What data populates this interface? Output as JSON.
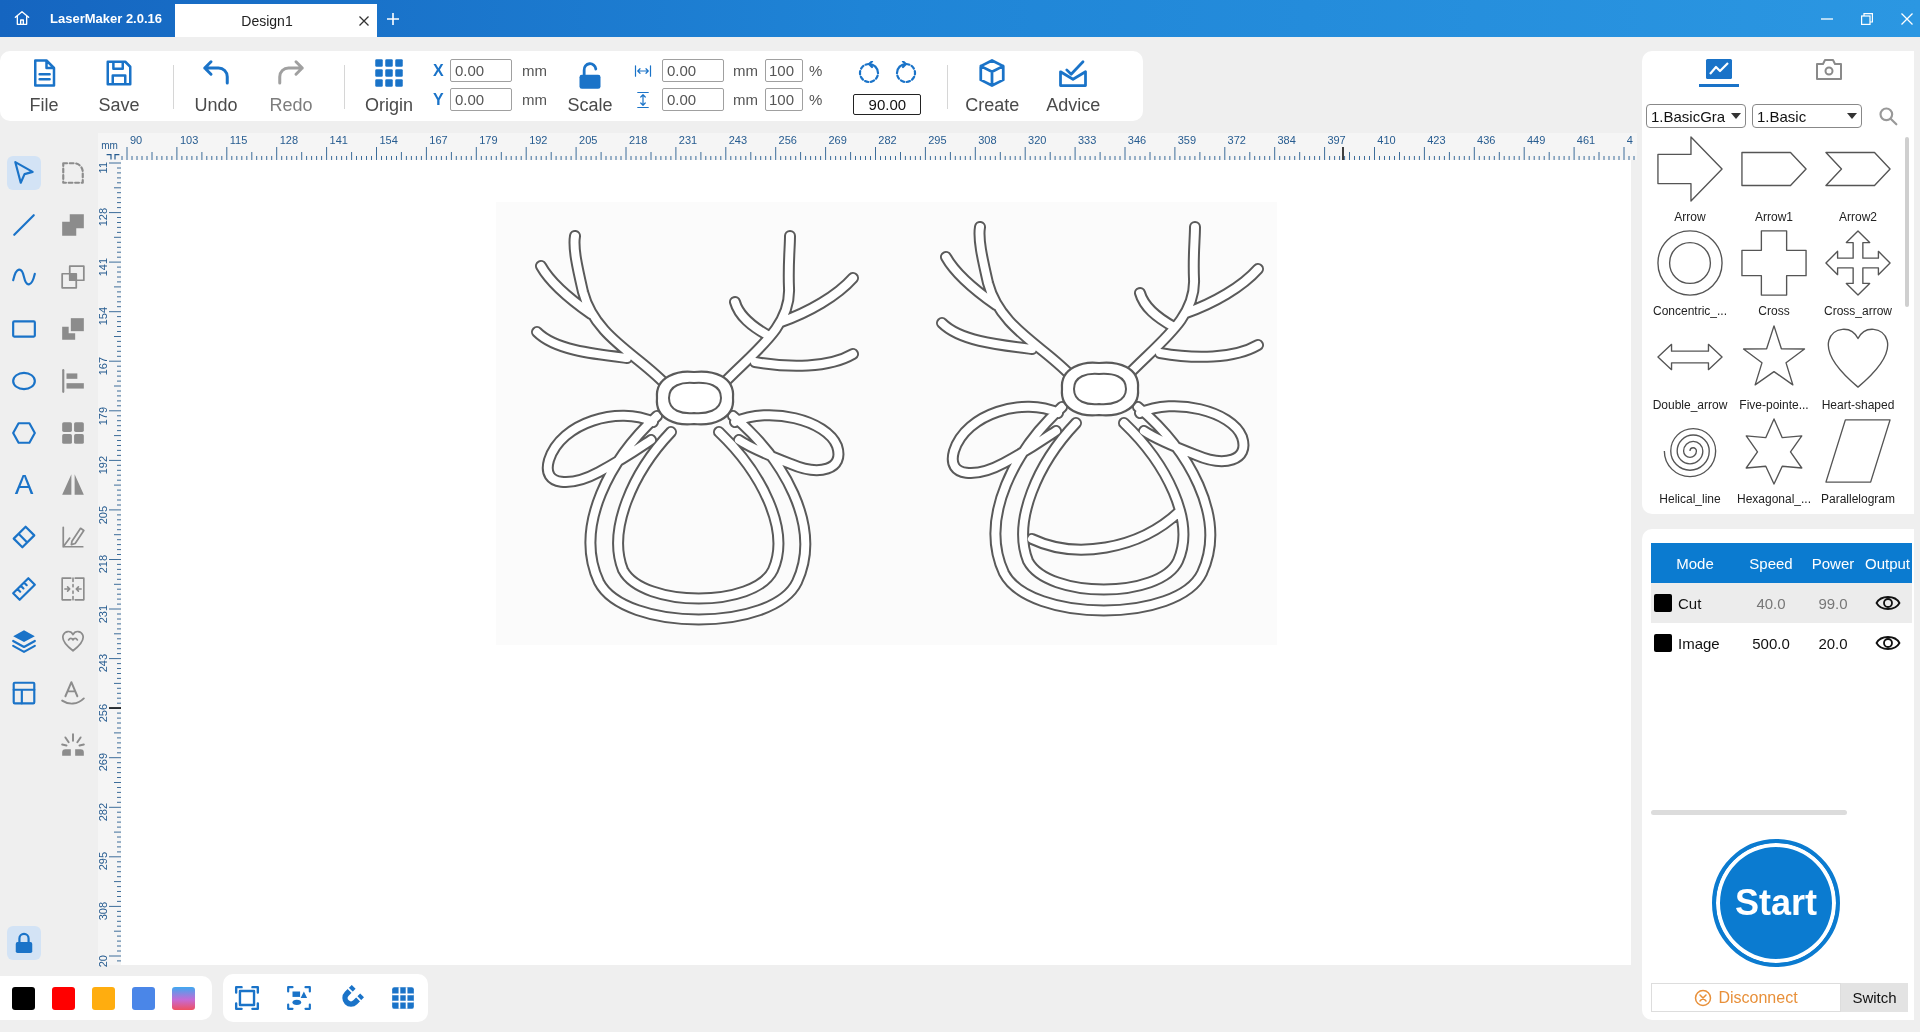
{
  "title_bar": {
    "app_name": "LaserMaker 2.0.16",
    "tabs": [
      {
        "label": "Design1",
        "selected": true
      }
    ]
  },
  "toolbar": {
    "file_buttons": [
      {
        "kind": "file",
        "label": "File",
        "disabled": false
      },
      {
        "kind": "save",
        "label": "Save",
        "disabled": false
      }
    ],
    "history_buttons": [
      {
        "kind": "undo",
        "label": "Undo",
        "disabled": false
      },
      {
        "kind": "redo",
        "label": "Redo",
        "disabled": true
      }
    ],
    "origin_button": {
      "label": "Origin"
    },
    "position_fields": [
      {
        "axis": "X",
        "value": "0.00",
        "unit": "mm"
      },
      {
        "axis": "Y",
        "value": "0.00",
        "unit": "mm"
      }
    ],
    "scale_button": {
      "label": "Scale",
      "locked": false
    },
    "size_fields": [
      {
        "kind": "width",
        "value": "0.00",
        "unit": "mm",
        "percent": "100",
        "percent_sign": "%"
      },
      {
        "kind": "height",
        "value": "0.00",
        "unit": "mm",
        "percent": "100",
        "percent_sign": "%"
      }
    ],
    "rotation": {
      "value": "90.00"
    },
    "action_buttons": [
      {
        "kind": "create",
        "label": "Create"
      },
      {
        "kind": "advice",
        "label": "Advice"
      }
    ]
  },
  "drawing_tools": [
    {
      "kind": "select",
      "selected": true
    },
    {
      "kind": "line",
      "selected": false
    },
    {
      "kind": "curve",
      "selected": false
    },
    {
      "kind": "rectangle",
      "selected": false
    },
    {
      "kind": "ellipse",
      "selected": false
    },
    {
      "kind": "polygon",
      "selected": false
    },
    {
      "kind": "text",
      "label": "A",
      "selected": false
    },
    {
      "kind": "eraser",
      "selected": false
    },
    {
      "kind": "measure",
      "selected": false
    },
    {
      "kind": "layers",
      "selected": false
    },
    {
      "kind": "layout",
      "selected": false
    }
  ],
  "lock": {
    "on": true
  },
  "edit_tools": [
    {
      "kind": "round_corner",
      "disabled": true
    },
    {
      "kind": "union",
      "disabled": true
    },
    {
      "kind": "intersect",
      "disabled": true
    },
    {
      "kind": "subtract",
      "disabled": true
    },
    {
      "kind": "align_left",
      "disabled": true
    },
    {
      "kind": "arrange",
      "disabled": true
    },
    {
      "kind": "mirror",
      "disabled": true
    },
    {
      "kind": "edit_angle",
      "disabled": true
    },
    {
      "kind": "split",
      "disabled": true
    },
    {
      "kind": "offset",
      "disabled": true
    },
    {
      "kind": "text_path",
      "disabled": true
    },
    {
      "kind": "scatter",
      "disabled": true
    }
  ],
  "rulers": {
    "unit": "mm",
    "top_labels": [
      "90",
      "103",
      "115",
      "128",
      "141",
      "154",
      "167",
      "179",
      "192",
      "205",
      "218",
      "231",
      "243",
      "256",
      "269",
      "282",
      "295",
      "308",
      "320",
      "333",
      "346",
      "359",
      "372",
      "384",
      "397",
      "410",
      "423",
      "436",
      "449",
      "461",
      "4"
    ],
    "left_labels": [
      "11",
      "128",
      "141",
      "154",
      "167",
      "179",
      "192",
      "205",
      "218",
      "231",
      "243",
      "256",
      "269",
      "282",
      "295",
      "308",
      "20"
    ]
  },
  "color_swatches": [
    {
      "kind": "solid",
      "color": "#000000"
    },
    {
      "kind": "solid",
      "color": "#ff0000"
    },
    {
      "kind": "solid",
      "color": "#ffad0f"
    },
    {
      "kind": "solid",
      "color": "#4a86e8"
    },
    {
      "kind": "gradient"
    }
  ],
  "view_tools": [
    {
      "kind": "frame"
    },
    {
      "kind": "select_all"
    },
    {
      "kind": "magnet"
    },
    {
      "kind": "grid"
    }
  ],
  "library": {
    "tabs": [
      {
        "kind": "graphics",
        "selected": true
      },
      {
        "kind": "camera",
        "selected": false
      }
    ],
    "category": "1.BasicGra",
    "subcategory": "1.Basic",
    "shapes": [
      {
        "kind": "arrow",
        "label": "Arrow"
      },
      {
        "kind": "arrow1",
        "label": "Arrow1"
      },
      {
        "kind": "arrow2",
        "label": "Arrow2"
      },
      {
        "kind": "concentric",
        "label": "Concentric_..."
      },
      {
        "kind": "cross",
        "label": "Cross"
      },
      {
        "kind": "cross_arrow",
        "label": "Cross_arrow"
      },
      {
        "kind": "double_arrow",
        "label": "Double_arrow"
      },
      {
        "kind": "star5",
        "label": "Five-pointe..."
      },
      {
        "kind": "heart",
        "label": "Heart-shaped"
      },
      {
        "kind": "spiral",
        "label": "Helical_line"
      },
      {
        "kind": "star6",
        "label": "Hexagonal_..."
      },
      {
        "kind": "parallelogram",
        "label": "Parallelogram"
      }
    ]
  },
  "layers": {
    "columns": [
      "Mode",
      "Speed",
      "Power",
      "Output"
    ],
    "rows": [
      {
        "color": "#000000",
        "mode": "Cut",
        "speed": "40.0",
        "power": "99.0",
        "output": true,
        "selected": true
      },
      {
        "color": "#000000",
        "mode": "Image",
        "speed": "500.0",
        "power": "20.0",
        "output": true,
        "selected": false
      }
    ]
  },
  "start_button": {
    "label": "Start"
  },
  "connection": {
    "status": "Disconnect",
    "switch_label": "Switch"
  }
}
